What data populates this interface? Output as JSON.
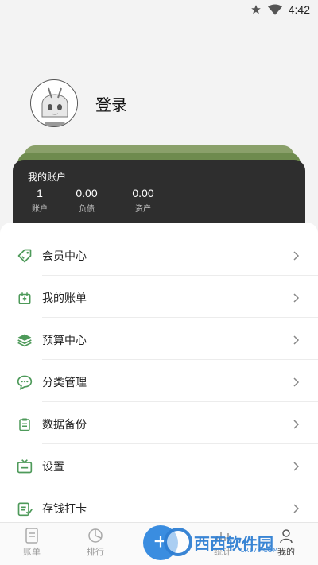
{
  "status_bar": {
    "time": "4:42"
  },
  "profile": {
    "login_label": "登录"
  },
  "account_card": {
    "title": "我的账户",
    "stats": [
      {
        "value": "1",
        "label": "账户"
      },
      {
        "value": "0.00",
        "label": "负债"
      },
      {
        "value": "0.00",
        "label": "资产"
      }
    ]
  },
  "menu": {
    "items": [
      {
        "label": "会员中心",
        "icon": "tag-icon"
      },
      {
        "label": "我的账单",
        "icon": "bill-icon"
      },
      {
        "label": "预算中心",
        "icon": "layers-icon"
      },
      {
        "label": "分类管理",
        "icon": "chat-icon"
      },
      {
        "label": "数据备份",
        "icon": "clipboard-icon"
      },
      {
        "label": "设置",
        "icon": "tv-icon"
      },
      {
        "label": "存钱打卡",
        "icon": "note-check-icon"
      }
    ]
  },
  "bottom_nav": {
    "items": [
      {
        "label": "账单",
        "icon": "ledger-icon"
      },
      {
        "label": "排行",
        "icon": "pie-icon"
      },
      {
        "label": "统计",
        "icon": "stats-icon"
      },
      {
        "label": "我的",
        "icon": "user-icon"
      }
    ],
    "fab_label": "+"
  },
  "watermark": {
    "text": "西西软件园",
    "sub": "CR173.COM"
  },
  "colors": {
    "accent_green": "#4e9a5a",
    "card_dark": "#2e2e2e",
    "card_green": "#6e8b4e"
  }
}
